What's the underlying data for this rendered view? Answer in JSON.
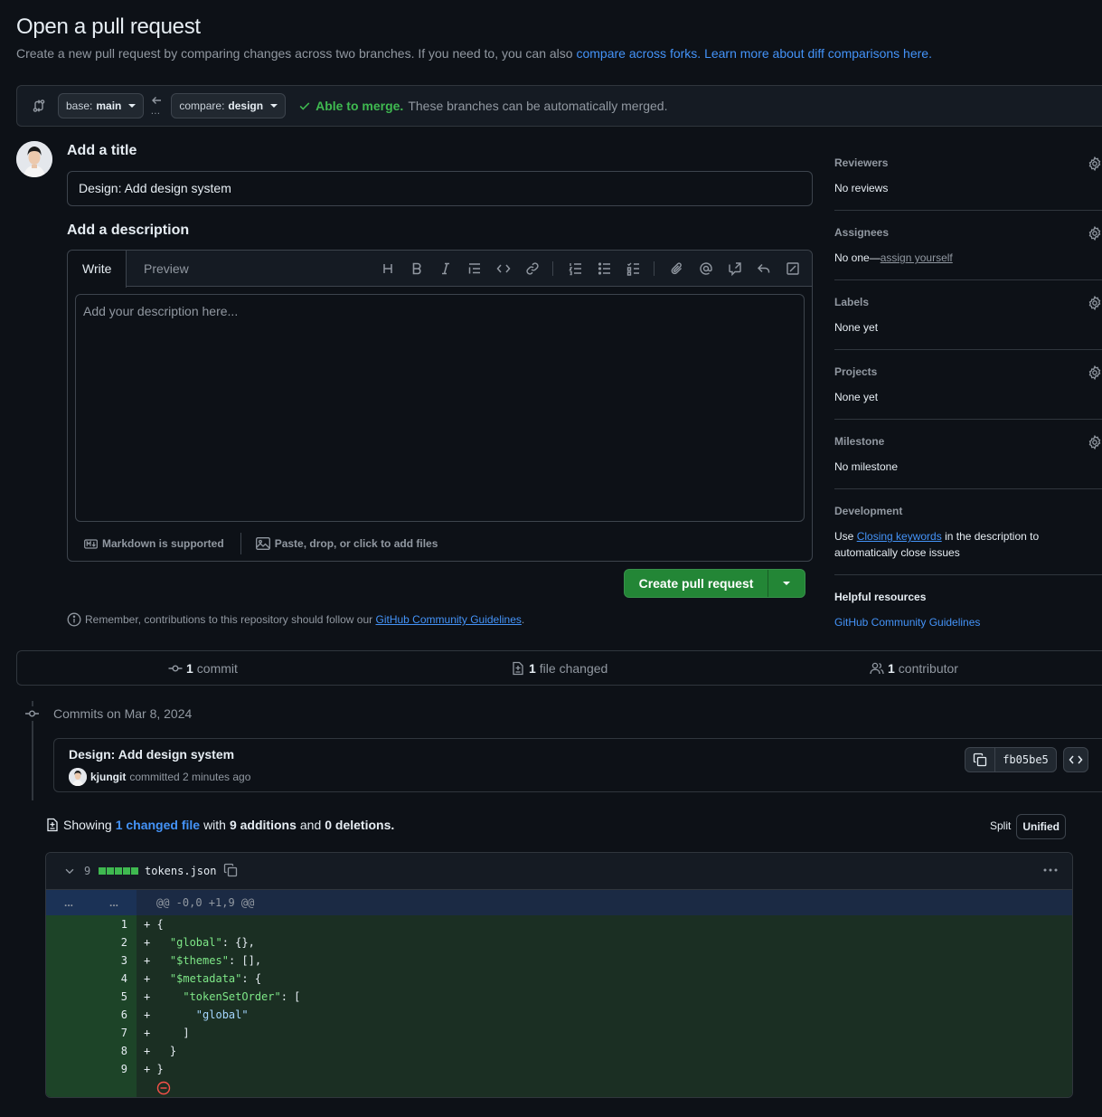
{
  "page": {
    "title": "Open a pull request",
    "subtitle_text": "Create a new pull request by comparing changes across two branches. If you need to, you can also ",
    "subtitle_link1": "compare across forks.",
    "subtitle_link2": "Learn more about diff comparisons here."
  },
  "compare": {
    "base_label": "base:",
    "base_value": "main",
    "compare_label": "compare:",
    "compare_value": "design",
    "merge_status": "Able to merge.",
    "merge_message": "These branches can be automatically merged."
  },
  "form": {
    "title_heading": "Add a title",
    "title_value": "Design: Add design system",
    "description_heading": "Add a description",
    "tab_write": "Write",
    "tab_preview": "Preview",
    "description_placeholder": "Add your description here...",
    "markdown_note": "Markdown is supported",
    "attach_note": "Paste, drop, or click to add files",
    "create_button": "Create pull request",
    "guidelines_prefix": "Remember, contributions to this repository should follow our ",
    "guidelines_link": "GitHub Community Guidelines",
    "guidelines_suffix": "."
  },
  "sidebar": {
    "reviewers": {
      "title": "Reviewers",
      "value": "No reviews"
    },
    "assignees": {
      "title": "Assignees",
      "value": "No one—",
      "link": "assign yourself"
    },
    "labels": {
      "title": "Labels",
      "value": "None yet"
    },
    "projects": {
      "title": "Projects",
      "value": "None yet"
    },
    "milestone": {
      "title": "Milestone",
      "value": "No milestone"
    },
    "development": {
      "title": "Development",
      "prefix": "Use ",
      "link": "Closing keywords",
      "suffix": " in the description to automatically close issues"
    },
    "helpful": {
      "title": "Helpful resources",
      "link": "GitHub Community Guidelines"
    }
  },
  "stats": {
    "commits_count": "1",
    "commits_label": "commit",
    "files_count": "1",
    "files_label": "file changed",
    "contributors_count": "1",
    "contributors_label": "contributor"
  },
  "commits": {
    "date_heading": "Commits on Mar 8, 2024",
    "title": "Design: Add design system",
    "author": "kjungit",
    "meta": "committed 2 minutes ago",
    "sha": "fb05be5"
  },
  "diff": {
    "showing_prefix": "Showing",
    "showing_link": "1 changed file",
    "showing_with": "with",
    "additions": "9 additions",
    "and": "and",
    "deletions": "0 deletions.",
    "split_label": "Split",
    "unified_label": "Unified",
    "file_changes": "9",
    "file_name": "tokens.json",
    "hunk_expand": "...",
    "hunk_header": "@@ -0,0 +1,9 @@",
    "lines": [
      {
        "n": "1",
        "code": "+ {"
      },
      {
        "n": "2",
        "code": "+   \"global\": {},"
      },
      {
        "n": "3",
        "code": "+   \"$themes\": [],"
      },
      {
        "n": "4",
        "code": "+   \"$metadata\": {"
      },
      {
        "n": "5",
        "code": "+     \"tokenSetOrder\": ["
      },
      {
        "n": "6",
        "code": "+       \"global\""
      },
      {
        "n": "7",
        "code": "+     ]"
      },
      {
        "n": "8",
        "code": "+   }"
      },
      {
        "n": "9",
        "code": "+ }"
      }
    ]
  },
  "colors": {
    "background": "#0d1117",
    "accent": "#4493f8",
    "success": "#3fb950",
    "primary_button": "#238636",
    "addition_bg": "#1b2f23"
  }
}
